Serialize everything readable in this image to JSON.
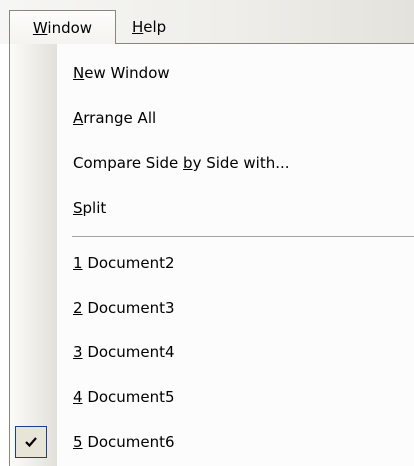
{
  "menubar": {
    "window": {
      "pre": "",
      "mnemonic": "W",
      "post": "indow"
    },
    "help": {
      "pre": "",
      "mnemonic": "H",
      "post": "elp"
    }
  },
  "menu": {
    "items": [
      {
        "pre": "",
        "mnemonic": "N",
        "post": "ew Window",
        "checked": false
      },
      {
        "pre": "",
        "mnemonic": "A",
        "post": "rrange All",
        "checked": false
      },
      {
        "pre": "Compare Side ",
        "mnemonic": "b",
        "post": "y Side with...",
        "checked": false
      },
      {
        "pre": "",
        "mnemonic": "S",
        "post": "plit",
        "checked": false
      },
      {
        "pre": "",
        "mnemonic": "1",
        "post": " Document2",
        "checked": false
      },
      {
        "pre": "",
        "mnemonic": "2",
        "post": " Document3",
        "checked": false
      },
      {
        "pre": "",
        "mnemonic": "3",
        "post": " Document4",
        "checked": false
      },
      {
        "pre": "",
        "mnemonic": "4",
        "post": " Document5",
        "checked": false
      },
      {
        "pre": "",
        "mnemonic": "5",
        "post": " Document6",
        "checked": true
      }
    ]
  },
  "icons": {
    "active_window": "checkmark-icon"
  },
  "colors": {
    "menu_border": "#8a867a",
    "check_border": "#1f3f8a",
    "check_fill": "#e7e4d8",
    "separator": "#a6a49c"
  }
}
